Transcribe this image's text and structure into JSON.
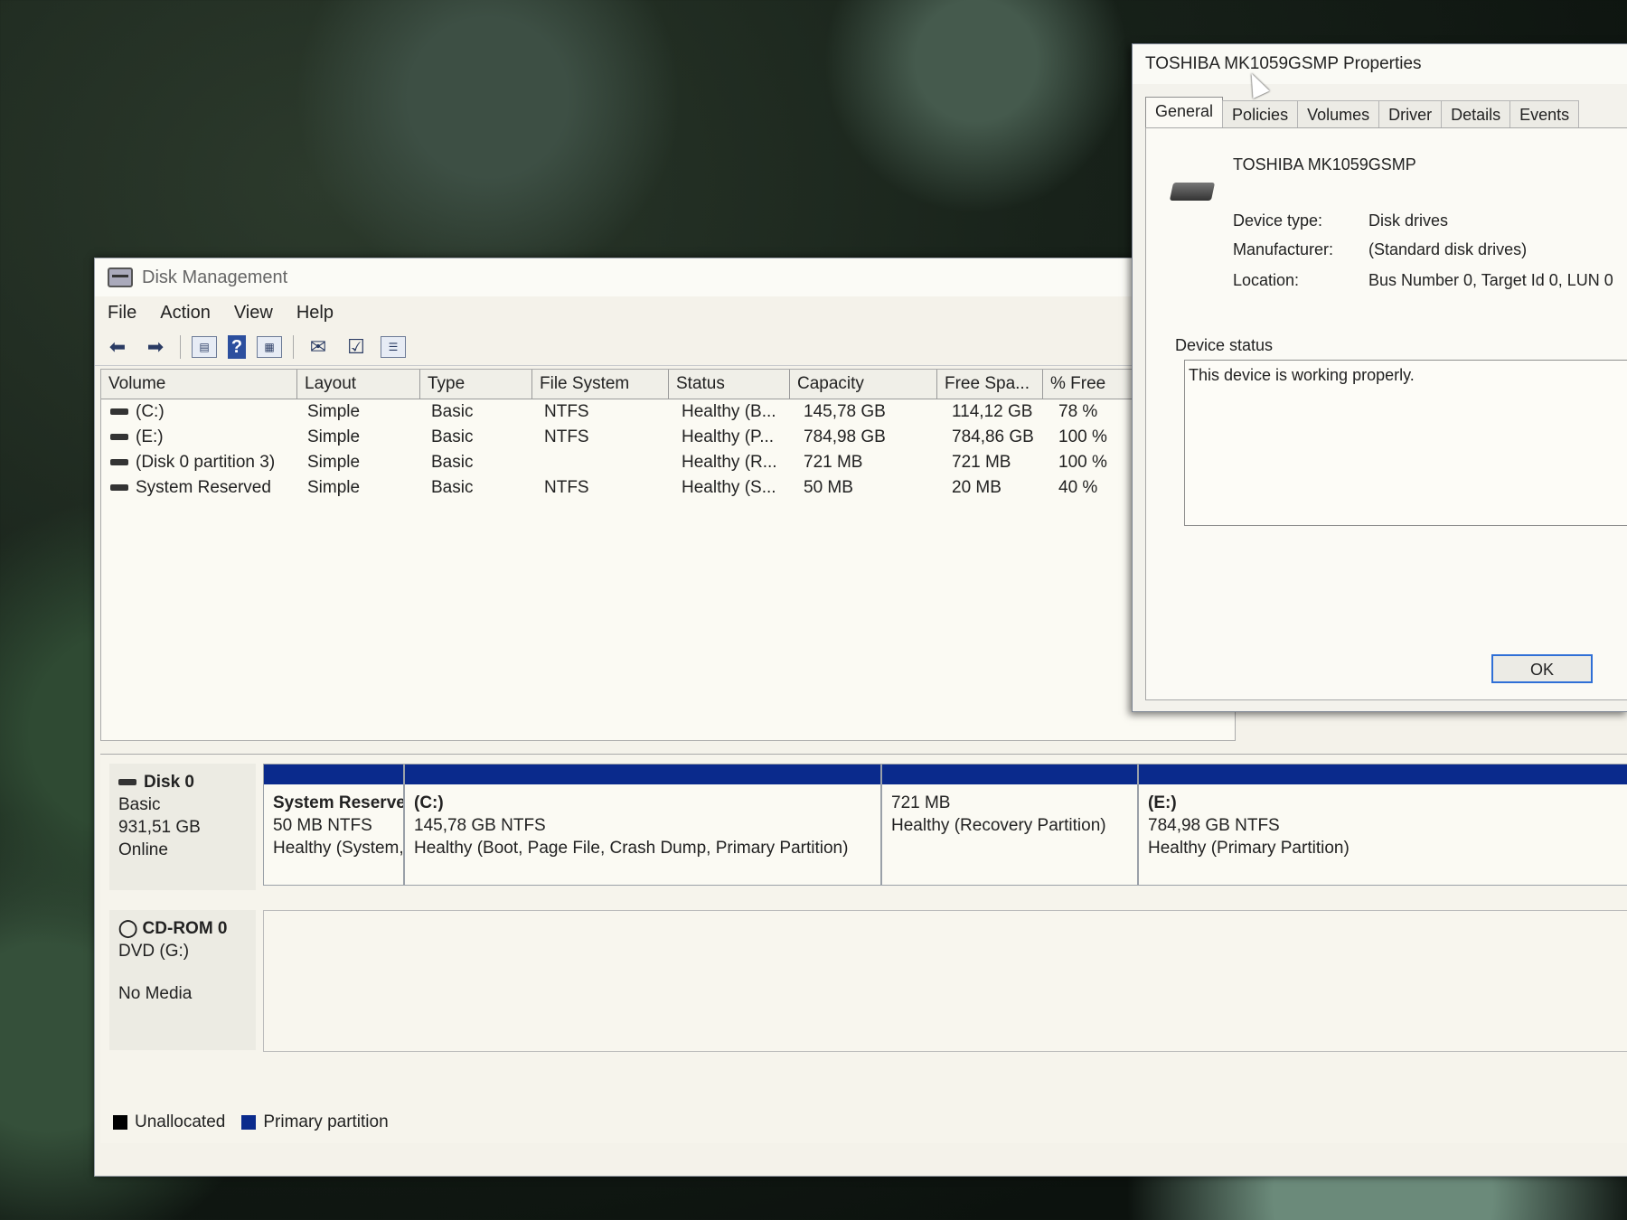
{
  "disk_management": {
    "title": "Disk Management",
    "menu": [
      "File",
      "Action",
      "View",
      "Help"
    ],
    "columns": [
      "Volume",
      "Layout",
      "Type",
      "File System",
      "Status",
      "Capacity",
      "Free Spa...",
      "% Free"
    ],
    "volumes": [
      {
        "volume": "(C:)",
        "layout": "Simple",
        "type": "Basic",
        "fs": "NTFS",
        "status": "Healthy (B...",
        "capacity": "145,78 GB",
        "free": "114,12 GB",
        "pct": "78 %"
      },
      {
        "volume": "(E:)",
        "layout": "Simple",
        "type": "Basic",
        "fs": "NTFS",
        "status": "Healthy (P...",
        "capacity": "784,98 GB",
        "free": "784,86 GB",
        "pct": "100 %"
      },
      {
        "volume": "(Disk 0 partition 3)",
        "layout": "Simple",
        "type": "Basic",
        "fs": "",
        "status": "Healthy (R...",
        "capacity": "721 MB",
        "free": "721 MB",
        "pct": "100 %"
      },
      {
        "volume": "System Reserved",
        "layout": "Simple",
        "type": "Basic",
        "fs": "NTFS",
        "status": "Healthy (S...",
        "capacity": "50 MB",
        "free": "20 MB",
        "pct": "40 %"
      }
    ],
    "disk0": {
      "name": "Disk 0",
      "type": "Basic",
      "size": "931,51 GB",
      "state": "Online",
      "partitions": [
        {
          "name": "System Reserve",
          "size": "50 MB NTFS",
          "status": "Healthy (System,"
        },
        {
          "name": "(C:)",
          "size": "145,78 GB NTFS",
          "status": "Healthy (Boot, Page File, Crash Dump, Primary Partition)"
        },
        {
          "name": "",
          "size": "721 MB",
          "status": "Healthy (Recovery Partition)"
        },
        {
          "name": "(E:)",
          "size": "784,98 GB NTFS",
          "status": "Healthy (Primary Partition)"
        }
      ]
    },
    "cdrom": {
      "name": "CD-ROM 0",
      "drive": "DVD (G:)",
      "media": "No Media"
    },
    "legend": {
      "unallocated": "Unallocated",
      "primary": "Primary partition",
      "unallocated_color": "#000000",
      "primary_color": "#0a2a8c"
    }
  },
  "properties": {
    "title": "TOSHIBA MK1059GSMP Properties",
    "tabs": [
      "General",
      "Policies",
      "Volumes",
      "Driver",
      "Details",
      "Events"
    ],
    "device_name": "TOSHIBA MK1059GSMP",
    "device_type_label": "Device type:",
    "device_type": "Disk drives",
    "manufacturer_label": "Manufacturer:",
    "manufacturer": "(Standard disk drives)",
    "location_label": "Location:",
    "location": "Bus Number 0, Target Id 0, LUN 0",
    "status_label": "Device status",
    "status_text": "This device is working properly.",
    "ok": "OK"
  }
}
